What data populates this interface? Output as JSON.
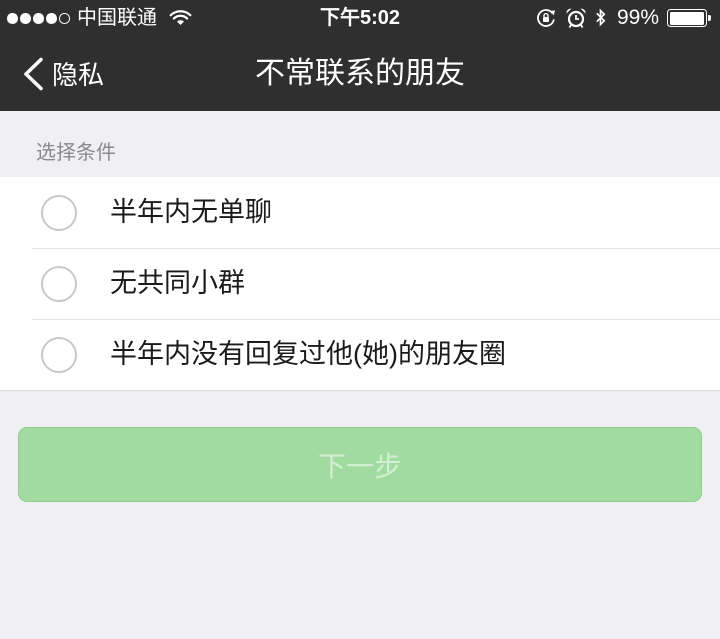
{
  "status_bar": {
    "signal_strength": 4,
    "signal_max": 5,
    "carrier": "中国联通",
    "time": "下午5:02",
    "battery_percent": "99%",
    "battery_level": 0.99,
    "icons": [
      "wifi-icon",
      "rotation-lock-icon",
      "alarm-icon",
      "bluetooth-icon",
      "battery-icon"
    ]
  },
  "nav": {
    "back_icon": "chevron-left-icon",
    "back_label": "隐私",
    "title": "不常联系的朋友"
  },
  "conditions": {
    "header": "选择条件",
    "options": [
      {
        "label": "半年内无单聊",
        "checked": false
      },
      {
        "label": "无共同小群",
        "checked": false
      },
      {
        "label": "半年内没有回复过他(她)的朋友圈",
        "checked": false
      }
    ]
  },
  "next_button": {
    "label": "下一步",
    "enabled": false
  },
  "colors": {
    "header_bg": "#2f2f30",
    "header_text": "#ffffff",
    "page_bg": "#efeff4",
    "list_bg": "#ffffff",
    "section_header_text": "#8a8a8a",
    "radio_border": "#c8c8c8",
    "button_disabled_bg": "#a1dba0",
    "button_disabled_border": "#8ccd8a",
    "button_disabled_text": "#d2efd1"
  }
}
